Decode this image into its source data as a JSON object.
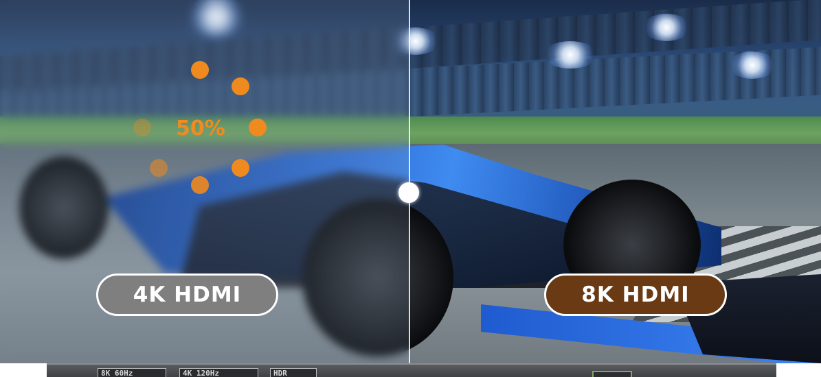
{
  "comparison": {
    "left_label": "4K HDMI",
    "right_label": "8K HDMI",
    "loading_text": "50%"
  },
  "colors": {
    "left_badge": "#7f7f7f",
    "right_badge": "#6a3a14",
    "loading_accent": "#ef8a1f",
    "divider": "#ffffff"
  },
  "loading": {
    "progress_percent": 50
  },
  "device_strip": {
    "spec_labels": [
      "8K 60Hz",
      "4K 120Hz",
      "HDR"
    ]
  }
}
